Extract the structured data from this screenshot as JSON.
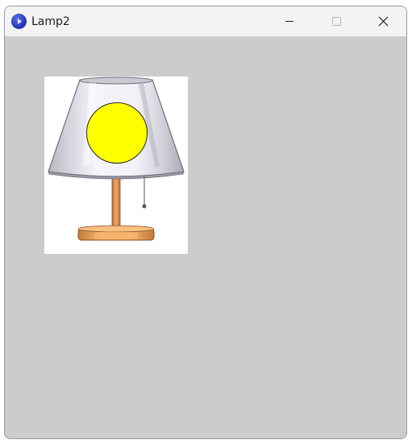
{
  "window": {
    "title": "Lamp2",
    "controls": {
      "minimize": "minimize-icon",
      "maximize": "maximize-icon",
      "close": "close-icon"
    },
    "client_background": "#cccccc"
  },
  "canvas": {
    "bulb_color": "#ffff00",
    "shade_color": "#e6e6ee",
    "base_color": "#e9a35e"
  }
}
